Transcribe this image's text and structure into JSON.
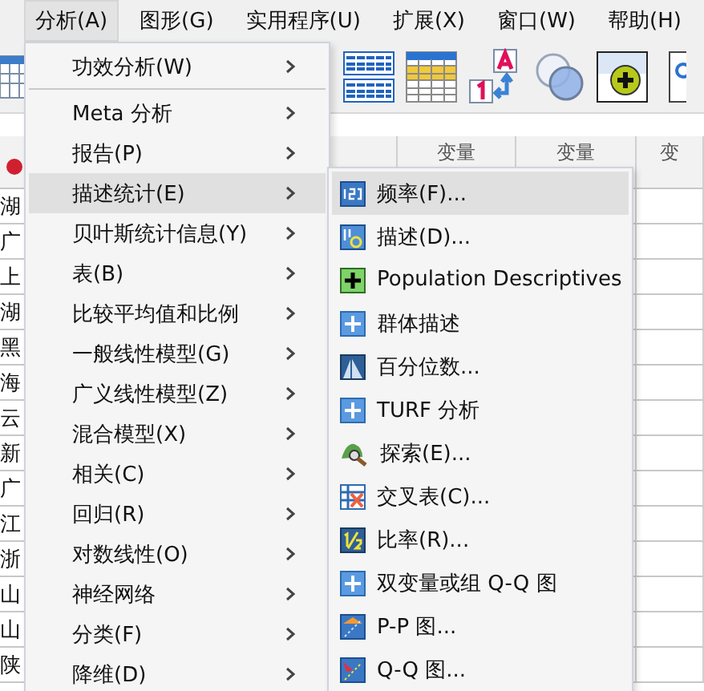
{
  "menubar": [
    {
      "label": "分析(A)",
      "selected": true
    },
    {
      "label": "图形(G)",
      "selected": false
    },
    {
      "label": "实用程序(U)",
      "selected": false
    },
    {
      "label": "扩展(X)",
      "selected": false
    },
    {
      "label": "窗口(W)",
      "selected": false
    },
    {
      "label": "帮助(H)",
      "selected": false
    }
  ],
  "grid": {
    "columns": [
      "变量",
      "变量",
      "变"
    ],
    "rows": [
      "湖",
      "广",
      "上",
      "湖",
      "黑",
      "海",
      "云",
      "新",
      "广",
      "江",
      "浙",
      "山",
      "山",
      "陕"
    ]
  },
  "menu": {
    "items": [
      {
        "kind": "submenu",
        "label": "功效分析(W)",
        "selected": false
      },
      {
        "kind": "separator"
      },
      {
        "kind": "submenu",
        "label": "Meta 分析",
        "selected": false
      },
      {
        "kind": "submenu",
        "label": "报告(P)",
        "selected": false
      },
      {
        "kind": "submenu",
        "label": "描述统计(E)",
        "selected": true
      },
      {
        "kind": "submenu",
        "label": "贝叶斯统计信息(Y)",
        "selected": false
      },
      {
        "kind": "submenu",
        "label": "表(B)",
        "selected": false
      },
      {
        "kind": "submenu",
        "label": "比较平均值和比例",
        "selected": false
      },
      {
        "kind": "submenu",
        "label": "一般线性模型(G)",
        "selected": false
      },
      {
        "kind": "submenu",
        "label": "广义线性模型(Z)",
        "selected": false
      },
      {
        "kind": "submenu",
        "label": "混合模型(X)",
        "selected": false
      },
      {
        "kind": "submenu",
        "label": "相关(C)",
        "selected": false
      },
      {
        "kind": "submenu",
        "label": "回归(R)",
        "selected": false
      },
      {
        "kind": "submenu",
        "label": "对数线性(O)",
        "selected": false
      },
      {
        "kind": "submenu",
        "label": "神经网络",
        "selected": false
      },
      {
        "kind": "submenu",
        "label": "分类(F)",
        "selected": false
      },
      {
        "kind": "submenu",
        "label": "降维(D)",
        "selected": false
      }
    ]
  },
  "submenu": {
    "items": [
      {
        "kind": "frequency",
        "label": "频率(F)...",
        "selected": true
      },
      {
        "kind": "descriptives",
        "label": "描述(D)...",
        "selected": false
      },
      {
        "kind": "extension",
        "label": "Population Descriptives",
        "selected": false
      },
      {
        "kind": "plugin",
        "label": "群体描述",
        "selected": false
      },
      {
        "kind": "percentile",
        "label": "百分位数...",
        "selected": false
      },
      {
        "kind": "plugin",
        "label": "TURF 分析",
        "selected": false
      },
      {
        "kind": "explore",
        "label": "探索(E)...",
        "selected": false
      },
      {
        "kind": "crosstab",
        "label": "交叉表(C)...",
        "selected": false
      },
      {
        "kind": "ratio",
        "label": "比率(R)...",
        "selected": false
      },
      {
        "kind": "plugin",
        "label": "双变量或组 Q-Q 图",
        "selected": false
      },
      {
        "kind": "pp",
        "label": "P-P 图...",
        "selected": false
      },
      {
        "kind": "qq",
        "label": "Q-Q 图...",
        "selected": false
      }
    ]
  }
}
